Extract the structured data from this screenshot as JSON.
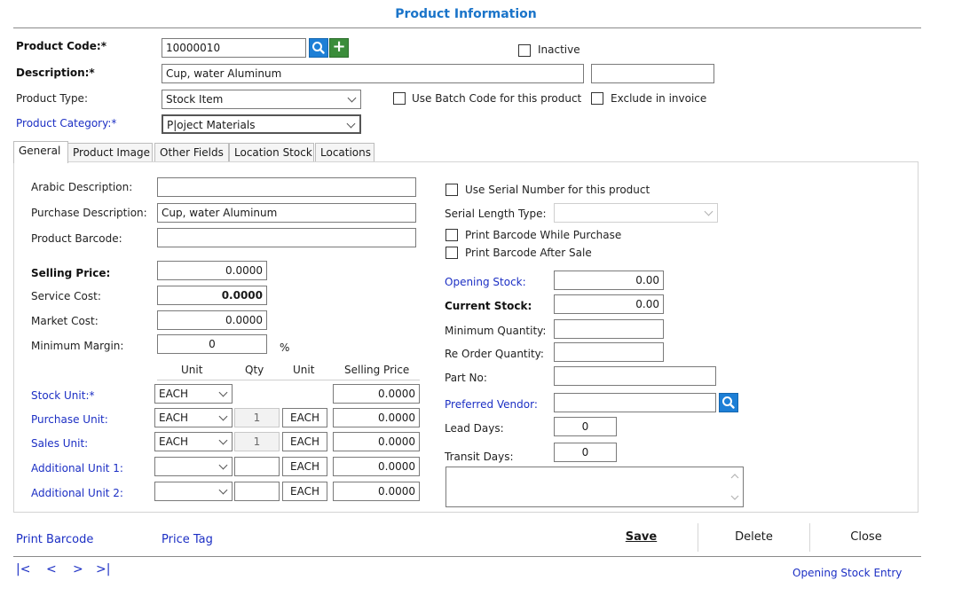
{
  "title": "Product Information",
  "header": {
    "product_code_label": "Product Code:*",
    "product_code_value": "10000010",
    "description_label": "Description:*",
    "description_value": "Cup, water Aluminum",
    "description_extra_value": "",
    "product_type_label": "Product Type:",
    "product_type_value": "Stock Item",
    "product_category_label": "Product Category:*",
    "product_category_value": "P|oject Materials",
    "inactive_label": "Inactive",
    "batch_code_label": "Use Batch Code for this product",
    "exclude_invoice_label": "Exclude in invoice"
  },
  "tabs": [
    "General",
    "Product Image",
    "Other Fields",
    "Location Stock",
    "Locations"
  ],
  "general": {
    "arabic_description_label": "Arabic Description:",
    "arabic_description_value": "",
    "purchase_description_label": "Purchase Description:",
    "purchase_description_value": "Cup, water Aluminum",
    "product_barcode_label": "Product Barcode:",
    "product_barcode_value": "",
    "selling_price_label": "Selling Price:",
    "selling_price_value": "0.0000",
    "service_cost_label": "Service Cost:",
    "service_cost_value": "0.0000",
    "market_cost_label": "Market Cost:",
    "market_cost_value": "0.0000",
    "minimum_margin_label": "Minimum Margin:",
    "minimum_margin_value": "0",
    "percent_sign": "%",
    "unit_headers": [
      "Unit",
      "Qty",
      "Unit",
      "Selling Price"
    ],
    "units": [
      {
        "label": "Stock Unit:*",
        "unit": "EACH",
        "qty": "",
        "base_unit": "",
        "price": "0.0000"
      },
      {
        "label": "Purchase Unit:",
        "unit": "EACH",
        "qty": "1",
        "base_unit": "EACH",
        "price": "0.0000"
      },
      {
        "label": "Sales Unit:",
        "unit": "EACH",
        "qty": "1",
        "base_unit": "EACH",
        "price": "0.0000"
      },
      {
        "label": "Additional Unit 1:",
        "unit": "",
        "qty": "",
        "base_unit": "EACH",
        "price": "0.0000"
      },
      {
        "label": "Additional Unit 2:",
        "unit": "",
        "qty": "",
        "base_unit": "EACH",
        "price": "0.0000"
      }
    ],
    "serial_number_label": "Use Serial Number for this product",
    "serial_length_label": "Serial Length Type:",
    "serial_length_value": "",
    "print_barcode_purchase_label": "Print Barcode While Purchase",
    "print_barcode_sale_label": "Print Barcode After Sale",
    "opening_stock_label": "Opening Stock:",
    "opening_stock_value": "0.00",
    "current_stock_label": "Current Stock:",
    "current_stock_value": "0.00",
    "minimum_quantity_label": "Minimum Quantity:",
    "minimum_quantity_value": "",
    "reorder_quantity_label": "Re Order Quantity:",
    "reorder_quantity_value": "",
    "part_no_label": "Part No:",
    "part_no_value": "",
    "preferred_vendor_label": "Preferred Vendor:",
    "preferred_vendor_value": "",
    "lead_days_label": "Lead Days:",
    "lead_days_value": "0",
    "transit_days_label": "Transit Days:",
    "transit_days_value": "0"
  },
  "footer": {
    "print_barcode": "Print Barcode",
    "price_tag": "Price Tag",
    "save": "Save",
    "delete": "Delete",
    "close": "Close",
    "nav_first": "|<",
    "nav_prev": "<",
    "nav_next": ">",
    "nav_last": ">|",
    "opening_stock_entry": "Opening Stock Entry"
  },
  "colors": {
    "title": "#1a74c9",
    "link": "#1c2fc4",
    "search_button": "#1d7fd6",
    "add_button": "#3b8d3b"
  }
}
